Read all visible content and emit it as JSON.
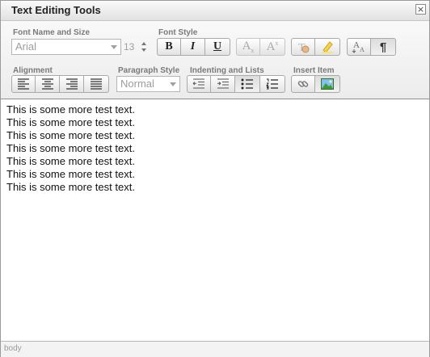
{
  "window": {
    "title": "Text Editing Tools",
    "close_glyph": "×"
  },
  "toolbar": {
    "font_group": {
      "label": "Font Name and Size",
      "font_name": "Arial",
      "font_size": "13"
    },
    "style_group": {
      "label": "Font Style",
      "bold_glyph": "B",
      "italic_glyph": "I",
      "underline_glyph": "U",
      "subscript_main": "A",
      "subscript_sub": "x",
      "superscript_main": "A",
      "superscript_sup": "x"
    },
    "alignment_group": {
      "label": "Alignment"
    },
    "paragraph_group": {
      "label": "Paragraph Style",
      "value": "Normal"
    },
    "indent_group": {
      "label": "Indenting and Lists"
    },
    "insert_group": {
      "label": "Insert Item"
    },
    "pilcrow_glyph": "¶"
  },
  "editor": {
    "lines": [
      "This is some more test text.",
      "This is some more test text.",
      "This is some more test text.",
      "This is some more test text.",
      "This is some more test text.",
      "This is some more test text.",
      "This is some more test text."
    ]
  },
  "statusbar": {
    "path": "body"
  },
  "icons": {
    "bold": "bold-icon",
    "italic": "italic-icon",
    "underline": "underline-icon",
    "subscript": "subscript-icon",
    "superscript": "superscript-icon",
    "clear_format": "clear-format-icon",
    "highlight": "highlight-icon",
    "font_size_adjust": "font-size-icon",
    "show_blocks": "pilcrow-icon",
    "align_left": "align-left-icon",
    "align_center": "align-center-icon",
    "align_right": "align-right-icon",
    "align_justify": "align-justify-icon",
    "outdent": "outdent-icon",
    "indent": "indent-icon",
    "bullet_list": "bullet-list-icon",
    "numbered_list": "numbered-list-icon",
    "link": "link-icon",
    "image": "image-icon"
  }
}
